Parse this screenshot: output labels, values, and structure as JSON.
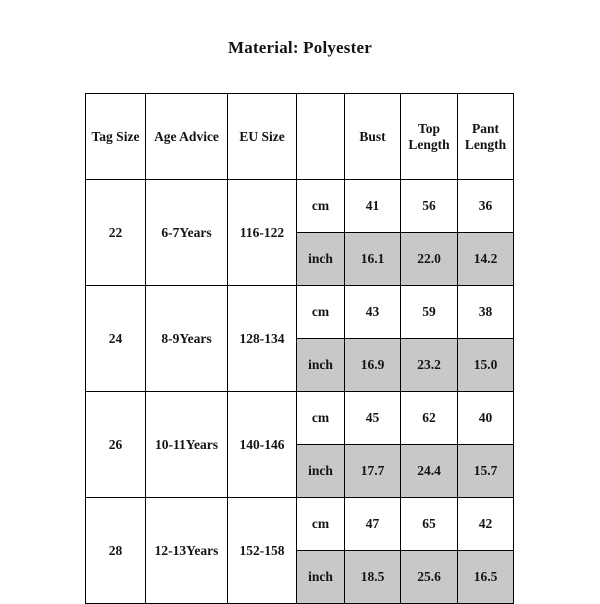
{
  "document": {
    "title": "Material: Polyester"
  },
  "table": {
    "headers": {
      "tag_size": "Tag Size",
      "age_advice": "Age Advice",
      "eu_size": "EU Size",
      "unit": "",
      "bust": "Bust",
      "top_length": "Top Length",
      "pant_length": "Pant Length"
    },
    "units": {
      "cm": "cm",
      "inch": "inch"
    },
    "rows": [
      {
        "tag_size": "22",
        "age_advice": "6-7Years",
        "eu_size": "116-122",
        "cm": {
          "bust": "41",
          "top_length": "56",
          "pant_length": "36"
        },
        "inch": {
          "bust": "16.1",
          "top_length": "22.0",
          "pant_length": "14.2"
        }
      },
      {
        "tag_size": "24",
        "age_advice": "8-9Years",
        "eu_size": "128-134",
        "cm": {
          "bust": "43",
          "top_length": "59",
          "pant_length": "38"
        },
        "inch": {
          "bust": "16.9",
          "top_length": "23.2",
          "pant_length": "15.0"
        }
      },
      {
        "tag_size": "26",
        "age_advice": "10-11Years",
        "eu_size": "140-146",
        "cm": {
          "bust": "45",
          "top_length": "62",
          "pant_length": "40"
        },
        "inch": {
          "bust": "17.7",
          "top_length": "24.4",
          "pant_length": "15.7"
        }
      },
      {
        "tag_size": "28",
        "age_advice": "12-13Years",
        "eu_size": "152-158",
        "cm": {
          "bust": "47",
          "top_length": "65",
          "pant_length": "42"
        },
        "inch": {
          "bust": "18.5",
          "top_length": "25.6",
          "pant_length": "16.5"
        }
      }
    ]
  },
  "colors": {
    "shaded_row_bg": "#c8c8c8",
    "border": "#000000",
    "text": "#141414",
    "page_bg": "#ffffff"
  }
}
